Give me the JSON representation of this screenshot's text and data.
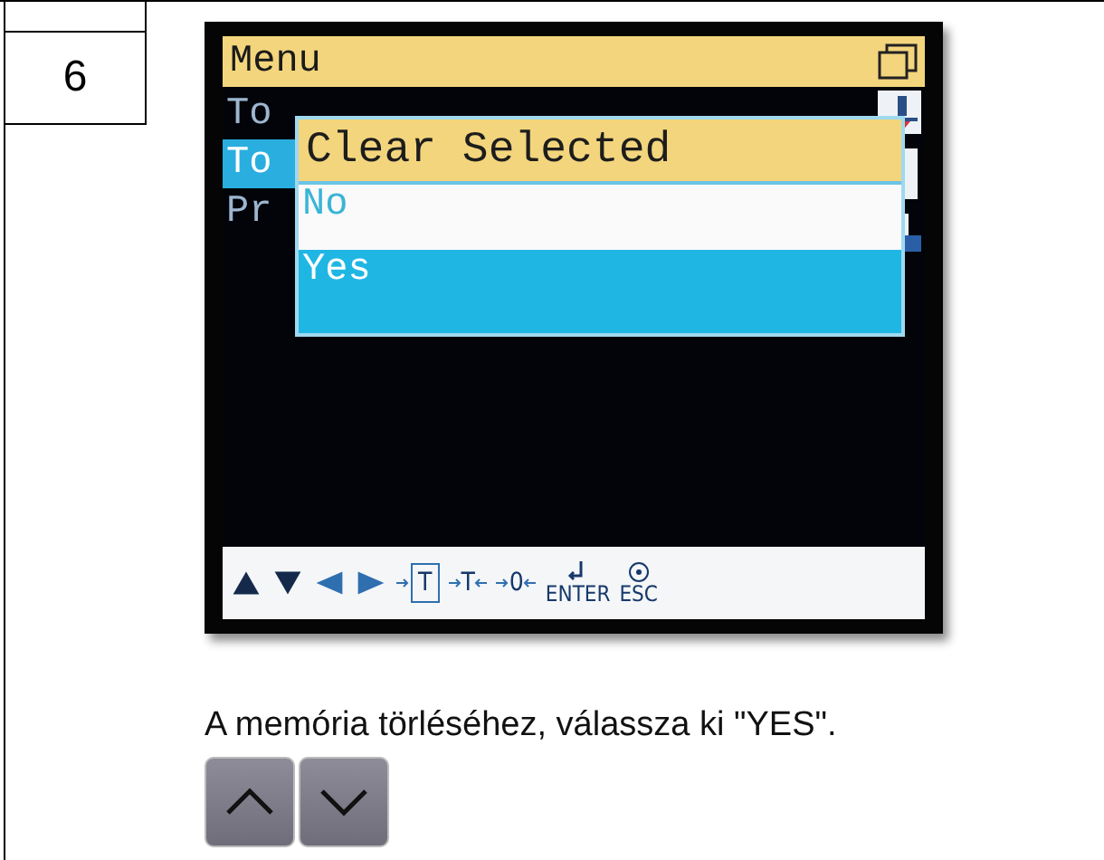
{
  "step": {
    "number": "6"
  },
  "device_screen": {
    "title": "Menu",
    "menu_items": [
      {
        "label": "To",
        "selected": false
      },
      {
        "label": "To",
        "selected": true
      },
      {
        "label": "Pr",
        "selected": false
      }
    ],
    "dialog": {
      "title": "Clear Selected",
      "options": [
        {
          "label": "No",
          "selected": false
        },
        {
          "label": "Yes",
          "selected": true
        }
      ]
    },
    "soft_keys": [
      {
        "kind": "up"
      },
      {
        "kind": "down"
      },
      {
        "kind": "left"
      },
      {
        "kind": "right"
      },
      {
        "kind": "tare-diamond",
        "label": "T"
      },
      {
        "kind": "arrows",
        "label": "T"
      },
      {
        "kind": "arrows",
        "label": "0"
      },
      {
        "kind": "enter",
        "label": "ENTER"
      },
      {
        "kind": "esc",
        "label": "ESC"
      }
    ]
  },
  "instruction": "A memória törléséhez, válassza ki \"YES\".",
  "keys": [
    {
      "kind": "up"
    },
    {
      "kind": "down"
    }
  ]
}
